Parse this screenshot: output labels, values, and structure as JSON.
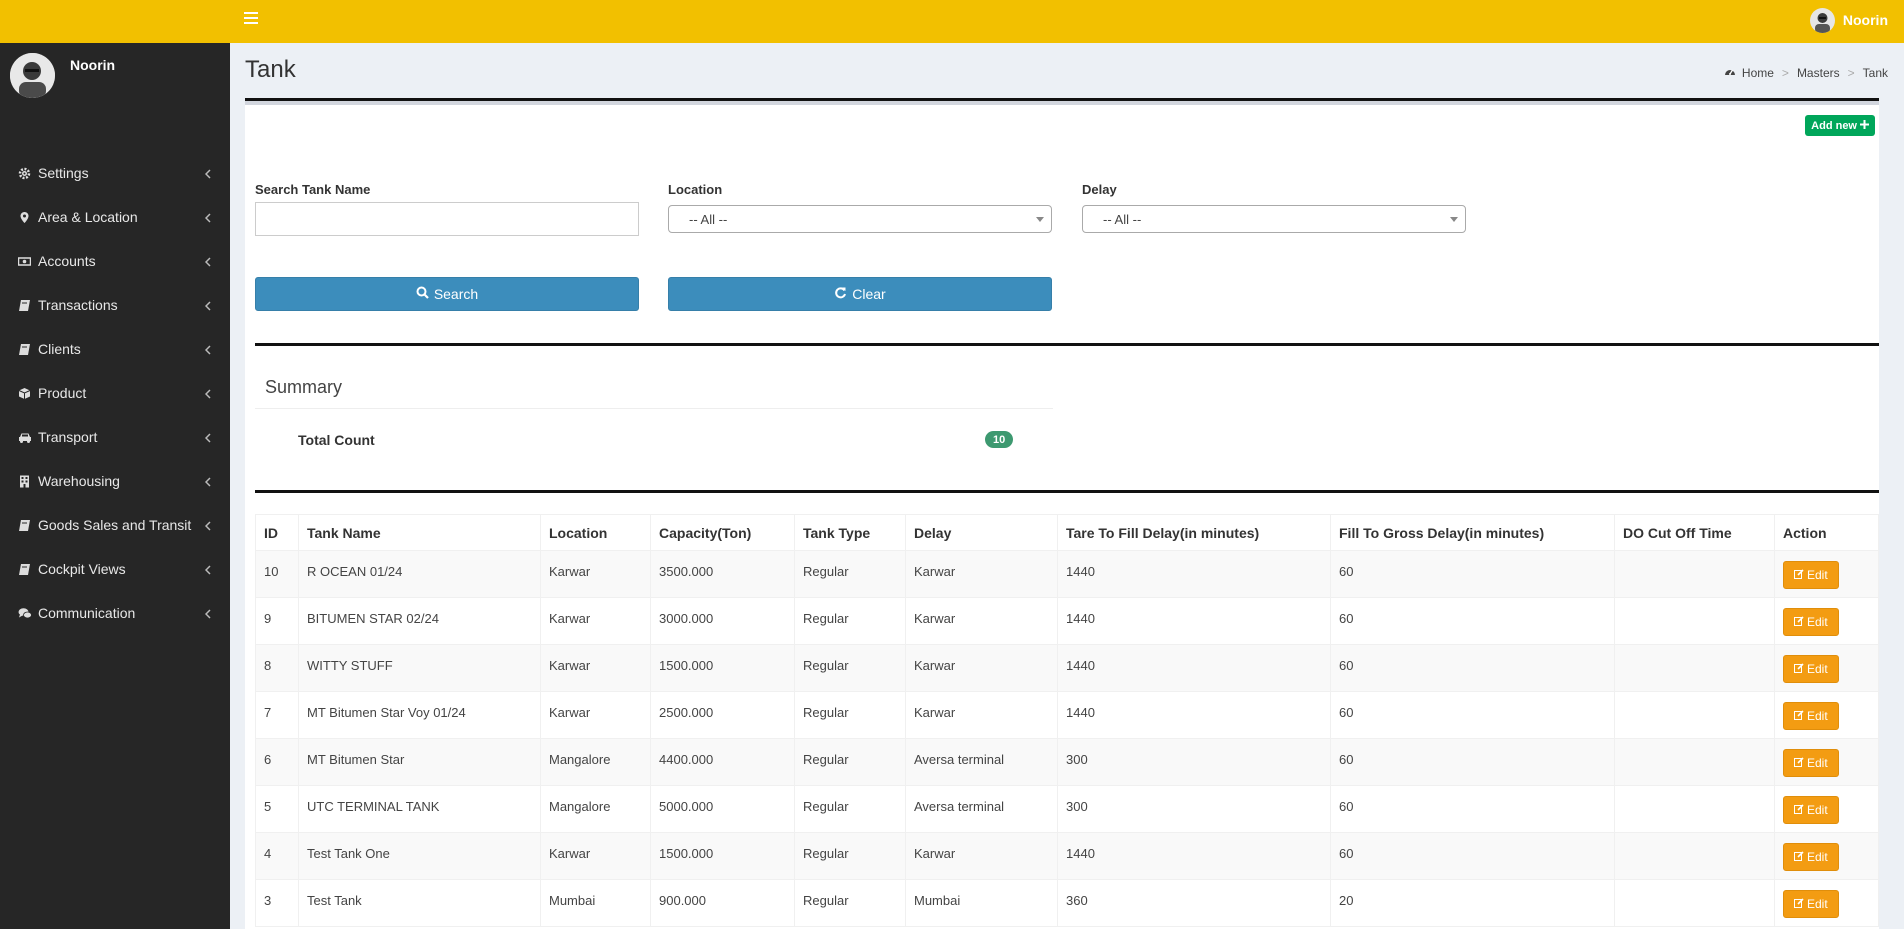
{
  "header": {
    "user_name": "Noorin"
  },
  "sidebar": {
    "user_name": "Noorin",
    "items": [
      {
        "label": "Settings",
        "icon": "gear-icon"
      },
      {
        "label": "Area & Location",
        "icon": "map-marker-icon"
      },
      {
        "label": "Accounts",
        "icon": "money-icon"
      },
      {
        "label": "Transactions",
        "icon": "book-icon"
      },
      {
        "label": "Clients",
        "icon": "book-icon"
      },
      {
        "label": "Product",
        "icon": "cube-icon"
      },
      {
        "label": "Transport",
        "icon": "car-icon"
      },
      {
        "label": "Warehousing",
        "icon": "building-icon"
      },
      {
        "label": "Goods Sales and Transit",
        "icon": "book-icon"
      },
      {
        "label": "Cockpit Views",
        "icon": "book-icon"
      },
      {
        "label": "Communication",
        "icon": "comments-icon"
      }
    ]
  },
  "page": {
    "title": "Tank",
    "breadcrumb": [
      "Home",
      "Masters",
      "Tank"
    ]
  },
  "toolbar": {
    "add_new_label": "Add new"
  },
  "filters": {
    "search_label": "Search Tank Name",
    "search_value": "",
    "location_label": "Location",
    "location_value": "-- All --",
    "delay_label": "Delay",
    "delay_value": "-- All --",
    "search_button": "Search",
    "clear_button": "Clear"
  },
  "summary": {
    "title": "Summary",
    "total_label": "Total Count",
    "total_value": "10"
  },
  "table": {
    "columns": [
      "ID",
      "Tank Name",
      "Location",
      "Capacity(Ton)",
      "Tank Type",
      "Delay",
      "Tare To Fill Delay(in minutes)",
      "Fill To Gross Delay(in minutes)",
      "DO Cut Off Time",
      "Action"
    ],
    "edit_label": "Edit",
    "rows": [
      {
        "id": "10",
        "name": "R OCEAN 01/24",
        "location": "Karwar",
        "capacity": "3500.000",
        "type": "Regular",
        "delay": "Karwar",
        "tare_fill": "1440",
        "fill_gross": "60",
        "cutoff": ""
      },
      {
        "id": "9",
        "name": "BITUMEN STAR 02/24",
        "location": "Karwar",
        "capacity": "3000.000",
        "type": "Regular",
        "delay": "Karwar",
        "tare_fill": "1440",
        "fill_gross": "60",
        "cutoff": ""
      },
      {
        "id": "8",
        "name": "WITTY STUFF",
        "location": "Karwar",
        "capacity": "1500.000",
        "type": "Regular",
        "delay": "Karwar",
        "tare_fill": "1440",
        "fill_gross": "60",
        "cutoff": ""
      },
      {
        "id": "7",
        "name": "MT Bitumen Star Voy 01/24",
        "location": "Karwar",
        "capacity": "2500.000",
        "type": "Regular",
        "delay": "Karwar",
        "tare_fill": "1440",
        "fill_gross": "60",
        "cutoff": ""
      },
      {
        "id": "6",
        "name": "MT Bitumen Star",
        "location": "Mangalore",
        "capacity": "4400.000",
        "type": "Regular",
        "delay": "Aversa terminal",
        "tare_fill": "300",
        "fill_gross": "60",
        "cutoff": ""
      },
      {
        "id": "5",
        "name": "UTC TERMINAL TANK",
        "location": "Mangalore",
        "capacity": "5000.000",
        "type": "Regular",
        "delay": "Aversa terminal",
        "tare_fill": "300",
        "fill_gross": "60",
        "cutoff": ""
      },
      {
        "id": "4",
        "name": "Test Tank One",
        "location": "Karwar",
        "capacity": "1500.000",
        "type": "Regular",
        "delay": "Karwar",
        "tare_fill": "1440",
        "fill_gross": "60",
        "cutoff": ""
      },
      {
        "id": "3",
        "name": "Test Tank",
        "location": "Mumbai",
        "capacity": "900.000",
        "type": "Regular",
        "delay": "Mumbai",
        "tare_fill": "360",
        "fill_gross": "20",
        "cutoff": ""
      }
    ]
  },
  "colors": {
    "topbar": "#f2c000",
    "sidebar": "#262626",
    "primary_button": "#3c8dbc",
    "add_button": "#00a65a",
    "edit_button": "#f39c12",
    "badge": "#3d9970"
  }
}
